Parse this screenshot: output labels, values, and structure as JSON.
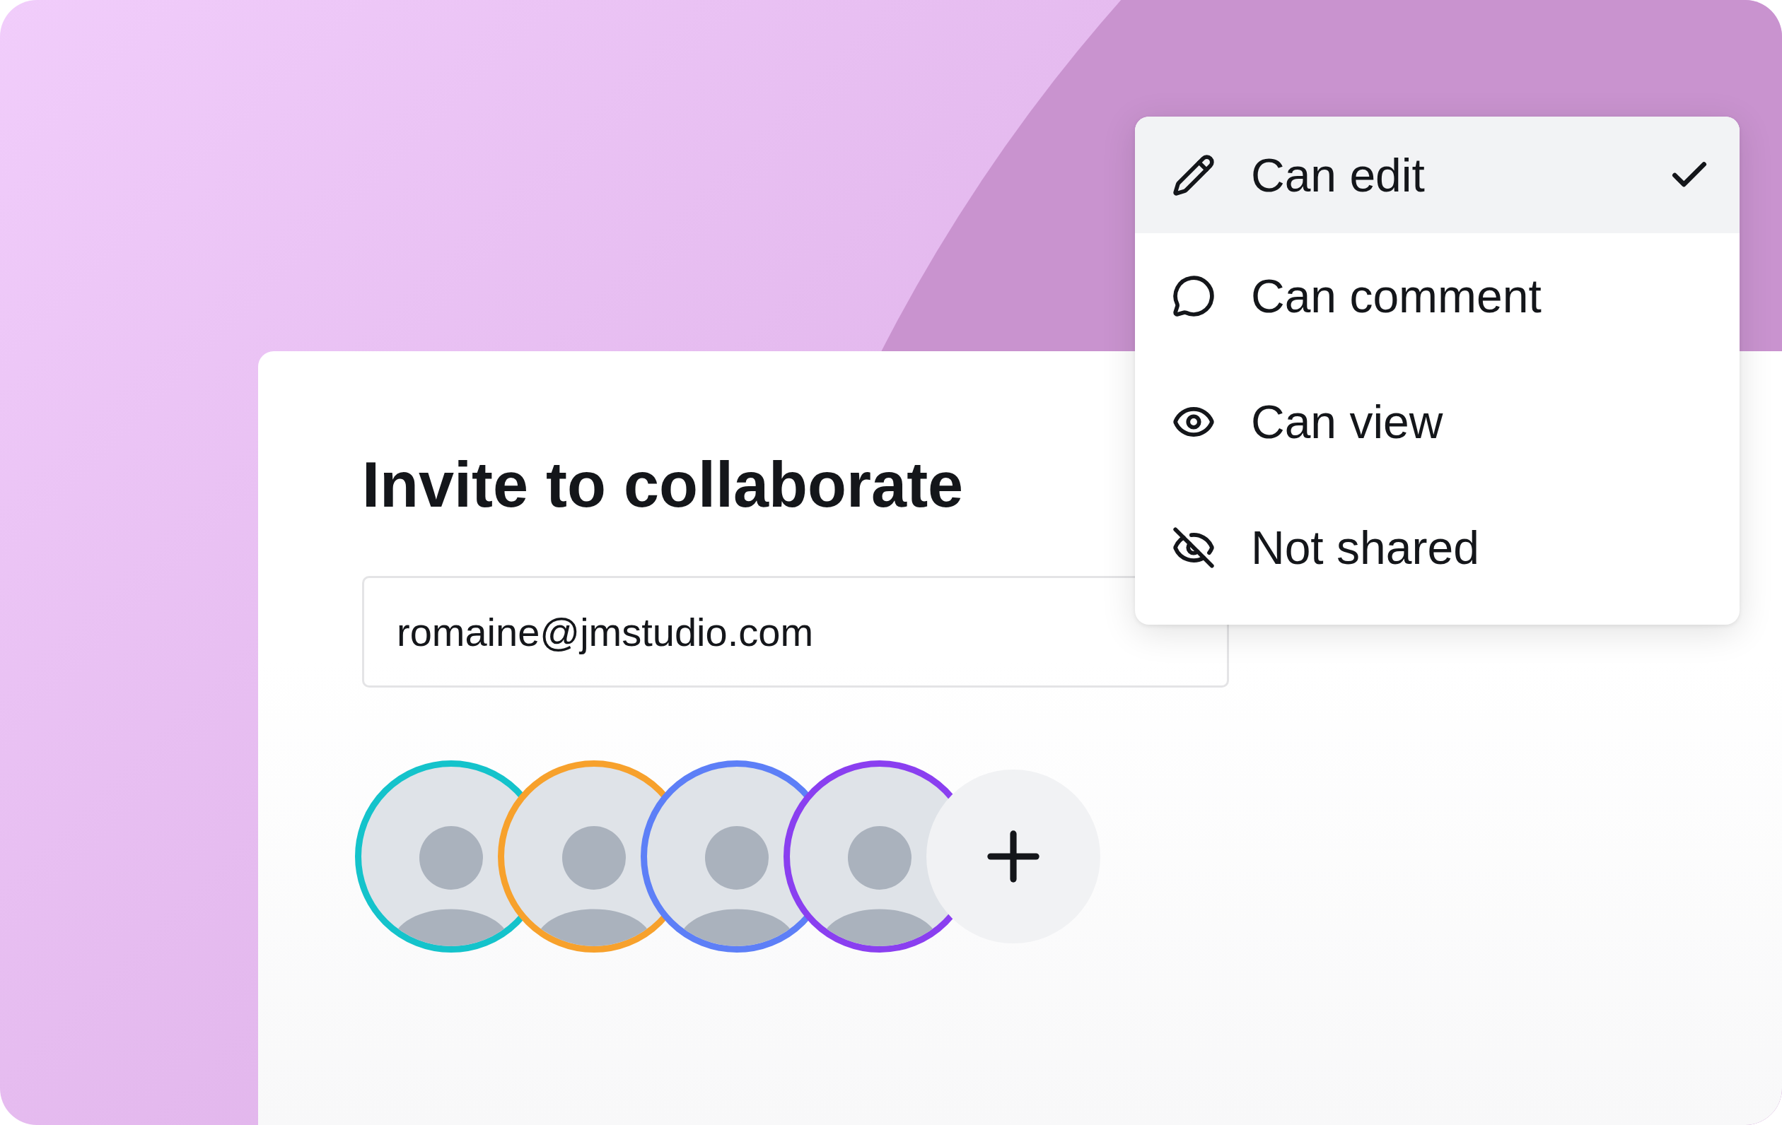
{
  "dialog": {
    "title": "Invite to collaborate",
    "email_field": {
      "value": "romaine@jmstudio.com"
    },
    "avatars": [
      {
        "color": "#14c3cb"
      },
      {
        "color": "#f7a12c"
      },
      {
        "color": "#5d7ff7"
      },
      {
        "color": "#8a3ff0"
      }
    ]
  },
  "permission_menu": {
    "items": [
      {
        "kind": "edit",
        "label": "Can edit",
        "selected": true
      },
      {
        "kind": "comment",
        "label": "Can comment",
        "selected": false
      },
      {
        "kind": "view",
        "label": "Can view",
        "selected": false
      },
      {
        "kind": "none",
        "label": "Not shared",
        "selected": false
      }
    ]
  }
}
